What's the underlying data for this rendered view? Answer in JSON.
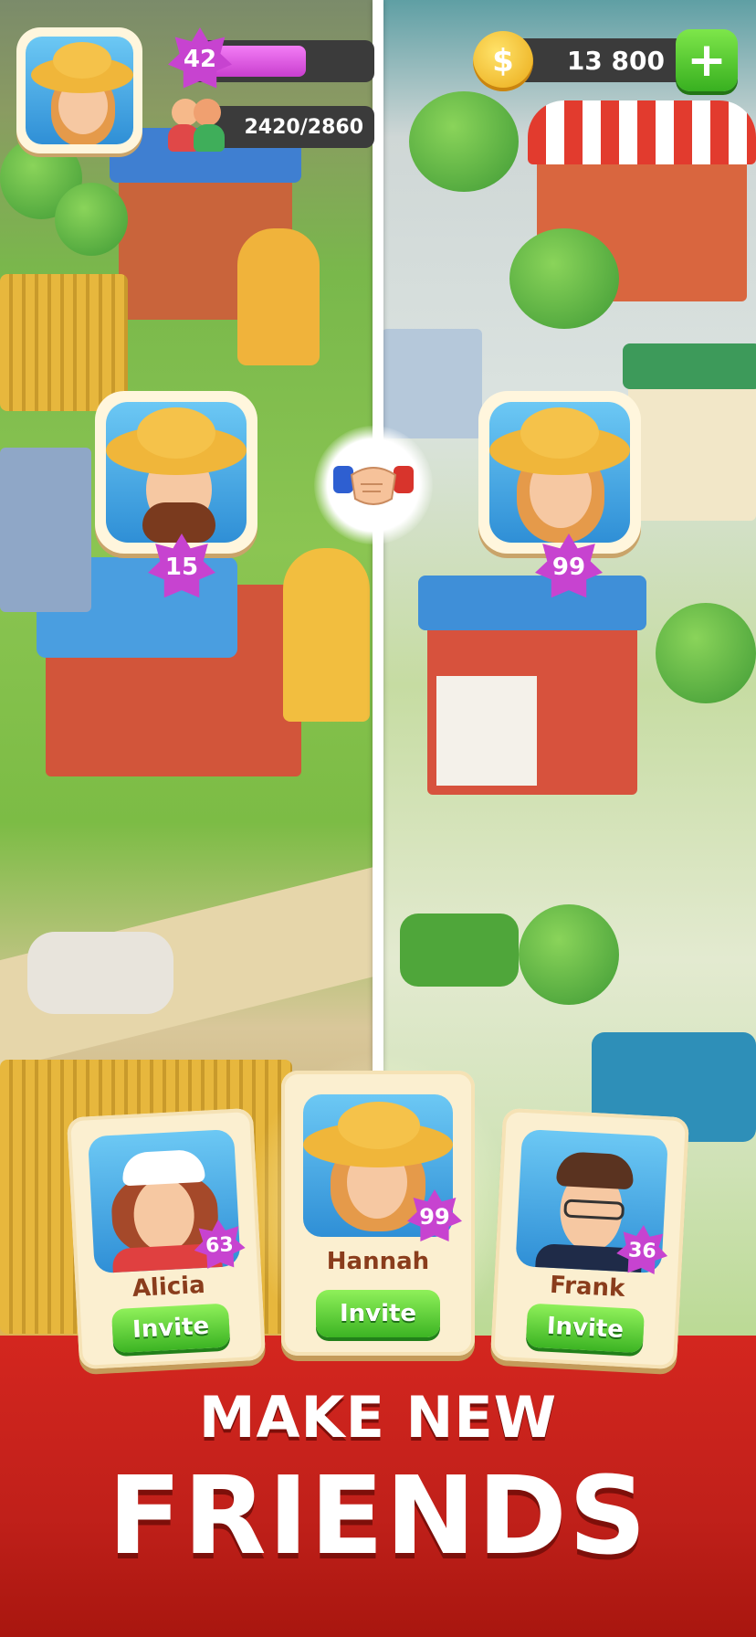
{
  "hud": {
    "level": "42",
    "xp_progress": 0.63,
    "population": "2420/2860",
    "coins": "13 800",
    "add_coins_symbol": "+",
    "coin_symbol": "$"
  },
  "left_player": {
    "level": "15"
  },
  "right_player": {
    "level": "99"
  },
  "friends": [
    {
      "name": "Alicia",
      "level": "63",
      "button": "Invite"
    },
    {
      "name": "Hannah",
      "level": "99",
      "button": "Invite"
    },
    {
      "name": "Frank",
      "level": "36",
      "button": "Invite"
    }
  ],
  "banner": {
    "line1": "MAKE NEW",
    "line2": "FRIENDS"
  },
  "colors": {
    "banner_red": "#c8231c",
    "invite_green": "#4cc12e",
    "level_purple": "#c743d0",
    "card_cream": "#fbefd0"
  },
  "icons": {
    "handshake": "handshake-icon",
    "coin": "coin-icon",
    "plus": "plus-icon",
    "population": "people-icon"
  }
}
